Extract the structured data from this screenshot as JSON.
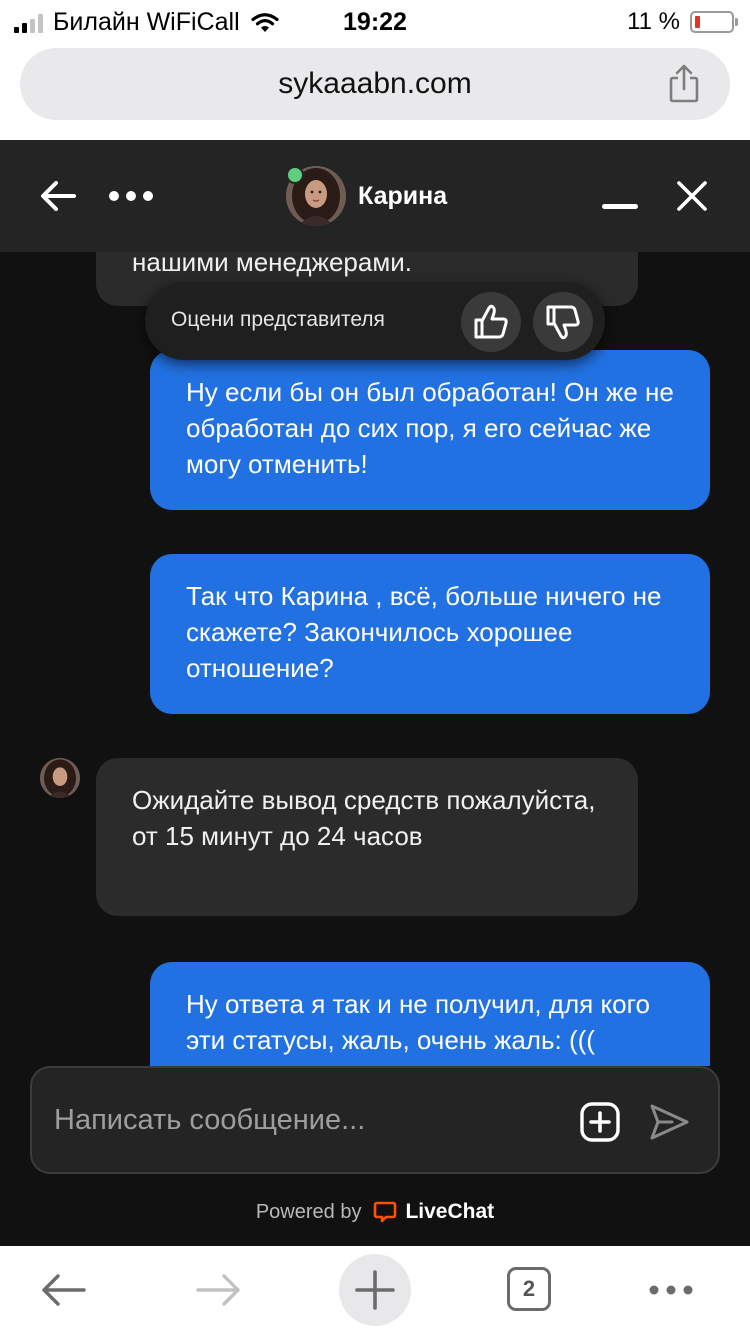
{
  "status_bar": {
    "carrier": "Билайн WiFiCall",
    "time": "19:22",
    "battery": "11 %"
  },
  "browser": {
    "url": "sykaaabn.com",
    "tabs_count": "2"
  },
  "chat": {
    "agent_name": "Карина",
    "rate_prompt": "Оцени представителя",
    "messages": [
      {
        "from": "agent",
        "text": "нашими менеджерами."
      },
      {
        "from": "user",
        "text": "Ну если бы он был обработан! Он же не обработан до сих пор, я его сейчас же могу отменить!"
      },
      {
        "from": "user",
        "text": "Так что Карина , всё, больше ничего не скажете? Закончилось хорошее отношение?"
      },
      {
        "from": "agent",
        "text": "Ожидайте вывод средств пожалуйста, от 15 минут до 24 часов"
      },
      {
        "from": "user",
        "text": "Ну ответа я так и не получил, для кого эти статусы, жаль, очень жаль: ((("
      }
    ],
    "composer_placeholder": "Написать сообщение...",
    "powered_by": "Powered by",
    "brand": "LiveChat"
  },
  "colors": {
    "user_bubble": "#2271e3",
    "agent_bubble": "#2b2b2b",
    "online": "#5fcf7e",
    "livechat": "#ff5100"
  }
}
